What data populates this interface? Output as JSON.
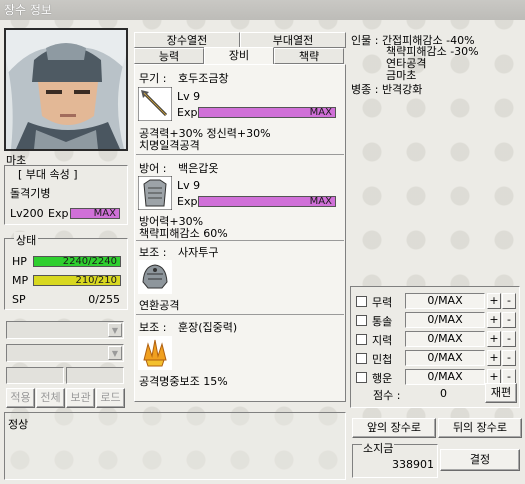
{
  "window": {
    "title": "장수 정보"
  },
  "general": {
    "name": "마초",
    "unit_group_label": "[ 부대 속성 ]",
    "unit_type": "돌격기병",
    "level_text": "Lv200",
    "exp_label": "Exp",
    "exp_value": "MAX"
  },
  "status": {
    "title": "상태",
    "hp_label": "HP",
    "hp_value": "2240/2240",
    "hp_fraction": 1.0,
    "mp_label": "MP",
    "mp_value": "210/210",
    "mp_fraction": 1.0,
    "sp_label": "SP",
    "sp_value": "0/255",
    "sp_fraction": 0.0,
    "colors": {
      "hp": "#2fcf2f",
      "mp": "#d8d820",
      "exp": "#d070d8"
    }
  },
  "left_buttons": [
    "적용",
    "전체",
    "보관",
    "로드"
  ],
  "tabs_top": [
    "장수열전",
    "부대열전"
  ],
  "tabs_bottom": [
    "능력",
    "장비",
    "책략"
  ],
  "equipment": {
    "weapon": {
      "slot_label": "무기 :",
      "name": "호두조금창",
      "level": "Lv 9",
      "exp_label": "Exp",
      "exp_value": "MAX",
      "exp_fraction": 1.0,
      "effect1": "공격력+30% 정신력+30%",
      "effect2": "치명일격공격"
    },
    "armor": {
      "slot_label": "방어 :",
      "name": "백은갑옷",
      "level": "Lv 9",
      "exp_label": "Exp",
      "exp_value": "MAX",
      "exp_fraction": 1.0,
      "effect1": "방어력+30%",
      "effect2": "책략피해감소 60%"
    },
    "aux1": {
      "slot_label": "보조 :",
      "name": "사자투구",
      "effect1": "연환공격"
    },
    "aux2": {
      "slot_label": "보조 :",
      "name": "훈장(집중력)",
      "effect1": "공격명중보조 15%"
    }
  },
  "special": {
    "line1": "인물 : 간접피해감소 -40%",
    "line2": "책략피해감소 -30%",
    "line3": "연타공격",
    "line4": "금마초",
    "line5": "병종 : 반격강화"
  },
  "stats": [
    {
      "name": "무력",
      "value": "0/MAX"
    },
    {
      "name": "통솔",
      "value": "0/MAX"
    },
    {
      "name": "지력",
      "value": "0/MAX"
    },
    {
      "name": "민첩",
      "value": "0/MAX"
    },
    {
      "name": "행운",
      "value": "0/MAX"
    }
  ],
  "points": {
    "label": "점수 :",
    "value": "0",
    "reroll_button": "재편"
  },
  "nav": {
    "prev_button": "앞의 장수로",
    "next_button": "뒤의 장수로"
  },
  "money": {
    "label": "소지금",
    "value": "338901",
    "confirm_button": "결정"
  },
  "bottom_text": "정상",
  "icons": {
    "plus": "+",
    "minus": "-",
    "dropdown": "▼"
  }
}
